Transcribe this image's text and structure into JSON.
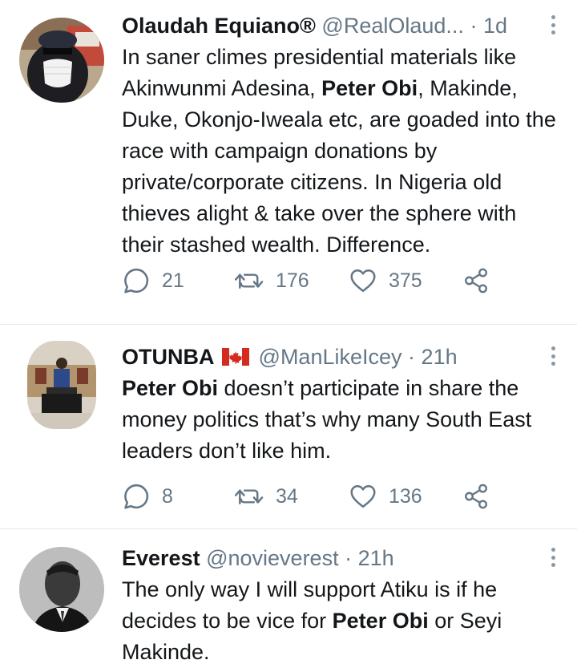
{
  "tweets": [
    {
      "name": "Olaudah Equiano®",
      "handle": "@RealOlaud...",
      "separator": "·",
      "time": "1d",
      "text_parts": [
        {
          "text": "In saner climes presidential materials like Akinwunmi Adesina, ",
          "bold": false
        },
        {
          "text": "Peter Obi",
          "bold": true
        },
        {
          "text": ", Makinde, Duke, Okonjo-Iweala etc, are goaded into the race with campaign donations by private/corporate citizens. In Nigeria old thieves alight & take over the sphere with their stashed wealth. Difference.",
          "bold": false
        }
      ],
      "replies": "21",
      "retweets": "176",
      "likes": "375"
    },
    {
      "name": "OTUNBA",
      "flag": "canada-flag-icon",
      "handle": "@ManLikeIcey",
      "separator": "·",
      "time": "21h",
      "text_parts": [
        {
          "text": "Peter Obi",
          "bold": true
        },
        {
          "text": " doesn’t participate in share the money politics that’s why many South East leaders don’t like him.",
          "bold": false
        }
      ],
      "replies": "8",
      "retweets": "34",
      "likes": "136"
    },
    {
      "name": "Everest",
      "handle": "@novieverest",
      "separator": "·",
      "time": "21h",
      "text_parts": [
        {
          "text": "The only way I will support Atiku is if he decides to be vice for ",
          "bold": false
        },
        {
          "text": "Peter Obi",
          "bold": true
        },
        {
          "text": " or Seyi Makinde.",
          "bold": false
        }
      ]
    }
  ],
  "icons": {
    "reply": "reply-icon",
    "retweet": "retweet-icon",
    "like": "heart-icon",
    "share": "share-icon",
    "more": "more-options-icon"
  },
  "colors": {
    "text": "#14171a",
    "secondary": "#657786",
    "divider": "#e1e8ed",
    "flag_red": "#d52b1e"
  }
}
